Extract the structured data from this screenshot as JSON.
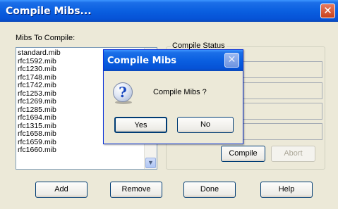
{
  "main": {
    "title": "Compile Mibs...",
    "close_icon": "close-icon",
    "mibs_label": "Mibs To Compile:",
    "mibs": [
      "standard.mib",
      "rfc1592.mib",
      "rfc1230.mib",
      "rfc1748.mib",
      "rfc1742.mib",
      "rfc1253.mib",
      "rfc1269.mib",
      "rfc1285.mib",
      "rfc1694.mib",
      "rfc1315.mib",
      "rfc1658.mib",
      "rfc1659.mib",
      "rfc1660.mib"
    ],
    "status_group_label": "Compile Status",
    "compile_label": "Compile",
    "abort_label": "Abort",
    "add_label": "Add",
    "remove_label": "Remove",
    "done_label": "Done",
    "help_label": "Help"
  },
  "dialog": {
    "title": "Compile Mibs",
    "message": "Compile Mibs ?",
    "icon": "question-icon",
    "yes_label": "Yes",
    "no_label": "No"
  },
  "colors": {
    "titlebar": "#0a5fe0",
    "close_red": "#c7411c",
    "face": "#ece9d8"
  }
}
